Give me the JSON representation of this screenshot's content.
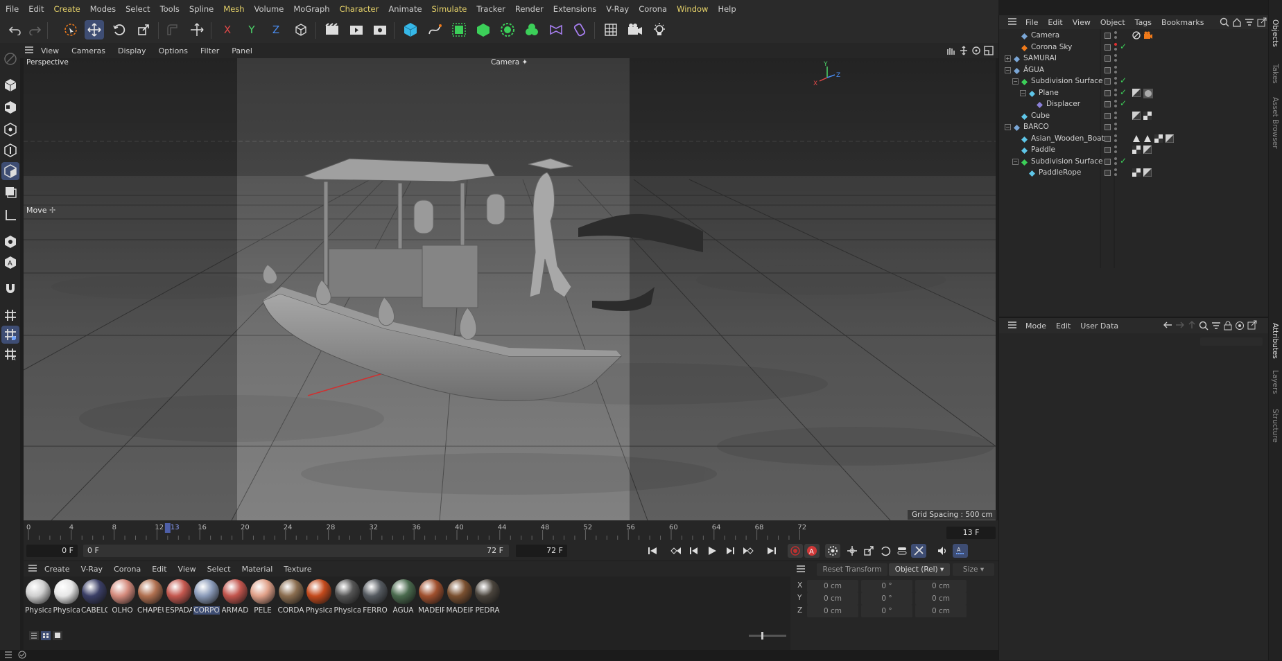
{
  "menubar": {
    "items": [
      "File",
      "Edit",
      "Create",
      "Modes",
      "Select",
      "Tools",
      "Spline",
      "Mesh",
      "Volume",
      "MoGraph",
      "Character",
      "Animate",
      "Simulate",
      "Tracker",
      "Render",
      "Extensions",
      "V-Ray",
      "Corona",
      "Window",
      "Help"
    ],
    "highlighted": [
      "Create",
      "Mesh",
      "Character",
      "Simulate",
      "Window"
    ]
  },
  "toolbar": {
    "icons": [
      "undo-icon",
      "redo-icon",
      "live-selection-icon",
      "move-icon",
      "rotate-icon",
      "scale-icon",
      "snap-icon",
      "coordinates-icon",
      "x-axis-icon",
      "y-axis-icon",
      "z-axis-icon",
      "object-coordinate-icon",
      "render-view-icon",
      "render-picture-viewer-icon",
      "render-settings-icon",
      "cube-icon",
      "pen-icon",
      "subdivision-icon",
      "extrude-icon",
      "cloner-icon",
      "mograph-icon",
      "deformer-icon",
      "field-icon",
      "floor-icon",
      "camera-icon",
      "light-icon"
    ],
    "axis_labels": {
      "x": "X",
      "y": "Y",
      "z": "Z"
    }
  },
  "viewport": {
    "menu": [
      "View",
      "Cameras",
      "Display",
      "Options",
      "Filter",
      "Panel"
    ],
    "label": "Perspective",
    "camera_label": "Camera ✦",
    "grid_spacing": "Grid Spacing : 500 cm",
    "move_label": "Move",
    "axis": {
      "x": "X",
      "y": "Y",
      "z": "Z"
    }
  },
  "timeline": {
    "ticks": [
      "0",
      "4",
      "8",
      "12",
      "13",
      "16",
      "20",
      "24",
      "28",
      "32",
      "36",
      "40",
      "44",
      "48",
      "52",
      "56",
      "60",
      "64",
      "68",
      "72"
    ],
    "current_frame": "13 F",
    "start_field": "0 F",
    "range_start": "0 F",
    "range_end": "72 F",
    "end_field": "72 F"
  },
  "materials": {
    "menu": [
      "Create",
      "V-Ray",
      "Corona",
      "Edit",
      "View",
      "Select",
      "Material",
      "Texture"
    ],
    "items": [
      {
        "name": "Physical.",
        "color": "#cfcfcf"
      },
      {
        "name": "Physical.",
        "color": "#e6e6e6"
      },
      {
        "name": "CABELO",
        "color": "#3b3f66"
      },
      {
        "name": "OLHO",
        "color": "#d48a7c"
      },
      {
        "name": "CHAPÉU",
        "color": "#b07050"
      },
      {
        "name": "ESPADA",
        "color": "#c4584f"
      },
      {
        "name": "CORPO",
        "color": "#8a9ab8"
      },
      {
        "name": "ARMADI",
        "color": "#c2554d"
      },
      {
        "name": "PELE",
        "color": "#e0a088"
      },
      {
        "name": "CORDA",
        "color": "#8a6d4f"
      },
      {
        "name": "Physical.",
        "color": "#c44a1c"
      },
      {
        "name": "Physical.",
        "color": "#555555"
      },
      {
        "name": "FERRO",
        "color": "#555a60"
      },
      {
        "name": "ÁGUA",
        "color": "#4a6a4e"
      },
      {
        "name": "MADEIR.",
        "color": "#a0502e"
      },
      {
        "name": "MADEIR.",
        "color": "#7a5030"
      },
      {
        "name": "PEDRA",
        "color": "#4a443c"
      }
    ],
    "selected_index": 6
  },
  "coordinates": {
    "reset_label": "Reset Transform",
    "mode_label": "Object (Rel)",
    "size_label": "Size",
    "rows": [
      {
        "axis": "X",
        "pos": "0 cm",
        "rot": "0 °",
        "size": "0 cm"
      },
      {
        "axis": "Y",
        "pos": "0 cm",
        "rot": "0 °",
        "size": "0 cm"
      },
      {
        "axis": "Z",
        "pos": "0 cm",
        "rot": "0 °",
        "size": "0 cm"
      }
    ]
  },
  "objects_panel": {
    "menu": [
      "File",
      "Edit",
      "View",
      "Object",
      "Tags",
      "Bookmarks"
    ],
    "rows": [
      {
        "name": "Camera",
        "indent": 1,
        "icon_color": "#7aa6d6",
        "expand": ""
      },
      {
        "name": "Corona Sky",
        "indent": 1,
        "icon_color": "#f07a1a",
        "expand": ""
      },
      {
        "name": "SAMURAI",
        "indent": 0,
        "icon_color": "#7aa6d6",
        "expand": "+"
      },
      {
        "name": "ÁGUA",
        "indent": 0,
        "icon_color": "#7aa6d6",
        "expand": "−"
      },
      {
        "name": "Subdivision Surface",
        "indent": 1,
        "icon_color": "#3ccf59",
        "expand": "−"
      },
      {
        "name": "Plane",
        "indent": 2,
        "icon_color": "#5fc6e8",
        "expand": "−"
      },
      {
        "name": "Displacer",
        "indent": 3,
        "icon_color": "#8a7fd6",
        "expand": ""
      },
      {
        "name": "Cube",
        "indent": 1,
        "icon_color": "#5fc6e8",
        "expand": ""
      },
      {
        "name": "BARCO",
        "indent": 0,
        "icon_color": "#7aa6d6",
        "expand": "−"
      },
      {
        "name": "Asian_Wooden_Boat",
        "indent": 1,
        "icon_color": "#5fc6e8",
        "expand": ""
      },
      {
        "name": "Paddle",
        "indent": 1,
        "icon_color": "#5fc6e8",
        "expand": ""
      },
      {
        "name": "Subdivision Surface",
        "indent": 1,
        "icon_color": "#3ccf59",
        "expand": "−"
      },
      {
        "name": "PaddleRope",
        "indent": 2,
        "icon_color": "#5fc6e8",
        "expand": ""
      }
    ]
  },
  "attributes_panel": {
    "menu": [
      "Mode",
      "Edit",
      "User Data"
    ]
  },
  "side_tabs": [
    "Objects",
    "Takes",
    "Asset Browser",
    "Attributes",
    "Layers",
    "Structure"
  ]
}
